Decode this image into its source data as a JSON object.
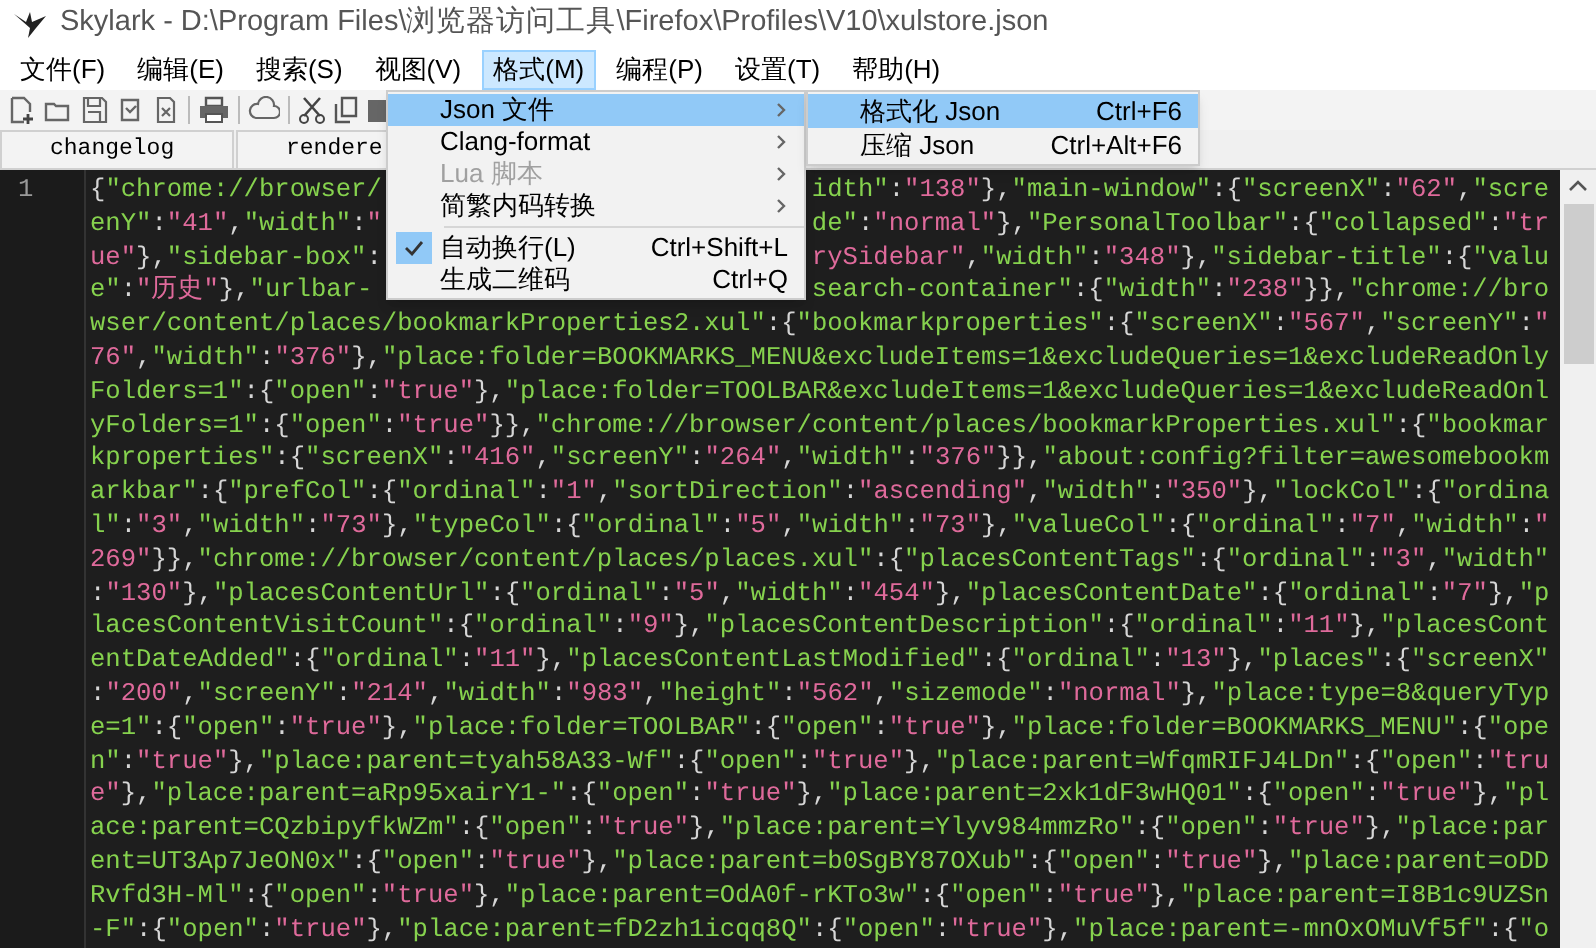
{
  "window": {
    "title": "Skylark - D:\\Program Files\\浏览器访问工具\\Firefox\\Profiles\\V10\\xulstore.json"
  },
  "menu_bar": [
    {
      "label": "文件(F)",
      "selected": false
    },
    {
      "label": "编辑(E)",
      "selected": false
    },
    {
      "label": "搜索(S)",
      "selected": false
    },
    {
      "label": "视图(V)",
      "selected": false
    },
    {
      "label": "格式(M)",
      "selected": true
    },
    {
      "label": "编程(P)",
      "selected": false
    },
    {
      "label": "设置(T)",
      "selected": false
    },
    {
      "label": "帮助(H)",
      "selected": false
    }
  ],
  "tabs": [
    {
      "label": "changelog",
      "selected": false
    },
    {
      "label": "rendere",
      "selected": false
    }
  ],
  "editor": {
    "line_numbers": [
      "1"
    ],
    "lines": [
      {
        "before": "{\"chrome://browser/",
        "after": "idth\":\"138\"},\"main-window\":{\"screenX\":\"62\",\"scre"
      },
      {
        "before": "enY\":\"41\",\"width\":\"",
        "after": "de\":\"normal\"},\"PersonalToolbar\":{\"collapsed\":\"tr"
      },
      {
        "before": "ue\"},\"sidebar-box\":",
        "after": "rySidebar\",\"width\":\"348\"},\"sidebar-title\":{\"valu"
      },
      {
        "before": "e\":\"历史\"},\"urlbar-",
        "after": "search-container\":{\"width\":\"238\"}},\"chrome://bro"
      },
      {
        "text": "wser/content/places/bookmarkProperties2.xul\":{\"bookmarkproperties\":{\"screenX\":\"567\",\"screenY\":\""
      },
      {
        "text": "76\",\"width\":\"376\"},\"place:folder=BOOKMARKS_MENU&excludeItems=1&excludeQueries=1&excludeReadOnly"
      },
      {
        "text": "Folders=1\":{\"open\":\"true\"},\"place:folder=TOOLBAR&excludeItems=1&excludeQueries=1&excludeReadOnl"
      },
      {
        "text": "yFolders=1\":{\"open\":\"true\"}},\"chrome://browser/content/places/bookmarkProperties.xul\":{\"bookmar"
      },
      {
        "text": "kproperties\":{\"screenX\":\"416\",\"screenY\":\"264\",\"width\":\"376\"}},\"about:config?filter=awesomebookm"
      },
      {
        "text": "arkbar\":{\"prefCol\":{\"ordinal\":\"1\",\"sortDirection\":\"ascending\",\"width\":\"350\"},\"lockCol\":{\"ordina"
      },
      {
        "text": "l\":\"3\",\"width\":\"73\"},\"typeCol\":{\"ordinal\":\"5\",\"width\":\"73\"},\"valueCol\":{\"ordinal\":\"7\",\"width\":\""
      },
      {
        "text": "269\"}},\"chrome://browser/content/places/places.xul\":{\"placesContentTags\":{\"ordinal\":\"3\",\"width\""
      },
      {
        "text": ":\"130\"},\"placesContentUrl\":{\"ordinal\":\"5\",\"width\":\"454\"},\"placesContentDate\":{\"ordinal\":\"7\"},\"p"
      },
      {
        "text": "lacesContentVisitCount\":{\"ordinal\":\"9\"},\"placesContentDescription\":{\"ordinal\":\"11\"},\"placesCont"
      },
      {
        "text": "entDateAdded\":{\"ordinal\":\"11\"},\"placesContentLastModified\":{\"ordinal\":\"13\"},\"places\":{\"screenX\""
      },
      {
        "text": ":\"200\",\"screenY\":\"214\",\"width\":\"983\",\"height\":\"562\",\"sizemode\":\"normal\"},\"place:type=8&queryTyp"
      },
      {
        "text": "e=1\":{\"open\":\"true\"},\"place:folder=TOOLBAR\":{\"open\":\"true\"},\"place:folder=BOOKMARKS_MENU\":{\"ope"
      },
      {
        "text": "n\":\"true\"},\"place:parent=tyah58A33-Wf\":{\"open\":\"true\"},\"place:parent=WfqmRIFJ4LDn\":{\"open\":\"tru"
      },
      {
        "text": "e\"},\"place:parent=aRp95xairY1-\":{\"open\":\"true\"},\"place:parent=2xk1dF3wHQ01\":{\"open\":\"true\"},\"pl"
      },
      {
        "text": "ace:parent=CQzbipyfkWZm\":{\"open\":\"true\"},\"place:parent=Ylyv984mmzRo\":{\"open\":\"true\"},\"place:par"
      },
      {
        "text": "ent=UT3Ap7JeON0x\":{\"open\":\"true\"},\"place:parent=b0SgBY87OXub\":{\"open\":\"true\"},\"place:parent=oDD"
      },
      {
        "text": "Rvfd3H-Ml\":{\"open\":\"true\"},\"place:parent=OdA0f-rKTo3w\":{\"open\":\"true\"},\"place:parent=I8B1c9UZSn"
      },
      {
        "text": "-F\":{\"open\":\"true\"},\"place:parent=fD2zh1icqq8Q\":{\"open\":\"true\"},\"place:parent=-mnOxOMuVf5f\":{\"o"
      }
    ]
  },
  "format_menu": {
    "items": [
      {
        "kind": "submenu",
        "label": "Json 文件",
        "selected": true,
        "disabled": false
      },
      {
        "kind": "submenu",
        "label": "Clang-format",
        "selected": false,
        "disabled": false
      },
      {
        "kind": "submenu",
        "label": "Lua 脚本",
        "selected": false,
        "disabled": true
      },
      {
        "kind": "submenu",
        "label": "简繁内码转换",
        "selected": false,
        "disabled": false
      },
      {
        "kind": "separator"
      },
      {
        "kind": "command",
        "label": "自动换行(L)",
        "shortcut": "Ctrl+Shift+L",
        "checked": true,
        "selected": false
      },
      {
        "kind": "command",
        "label": "生成二维码",
        "shortcut": "Ctrl+Q",
        "checked": false,
        "selected": false
      }
    ]
  },
  "json_submenu": {
    "items": [
      {
        "label": "格式化 Json",
        "shortcut": "Ctrl+F6",
        "selected": true
      },
      {
        "label": "压缩 Json",
        "shortcut": "Ctrl+Alt+F6",
        "selected": false
      }
    ]
  }
}
